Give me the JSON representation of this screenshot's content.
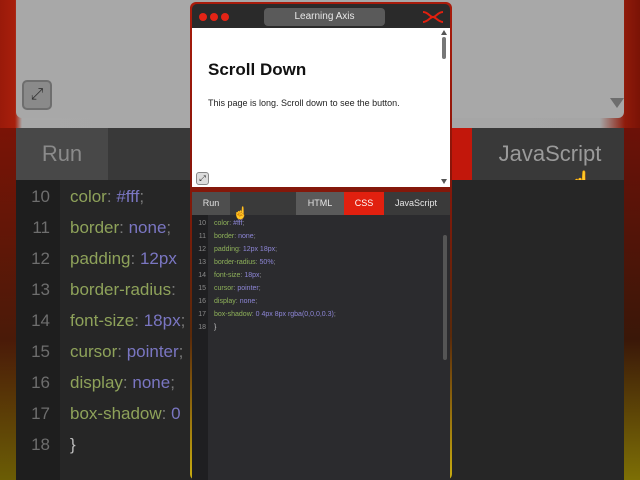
{
  "app": {
    "title": "Learning Axis",
    "brand_color": "#e1200f"
  },
  "preview": {
    "heading": "Scroll Down",
    "body": "This page is long. Scroll down to see the button."
  },
  "tabs": {
    "run": "Run",
    "html": "HTML",
    "css": "CSS",
    "javascript": "JavaScript",
    "active": "CSS"
  },
  "code": {
    "lines": [
      {
        "n": "10",
        "prop": "color",
        "val": "#fff"
      },
      {
        "n": "11",
        "prop": "border",
        "val": "none"
      },
      {
        "n": "12",
        "prop": "padding",
        "val": "12px 18px"
      },
      {
        "n": "13",
        "prop": "border-radius",
        "val": "50%"
      },
      {
        "n": "14",
        "prop": "font-size",
        "val": "18px"
      },
      {
        "n": "15",
        "prop": "cursor",
        "val": "pointer"
      },
      {
        "n": "16",
        "prop": "display",
        "val": "none"
      },
      {
        "n": "17",
        "prop": "box-shadow",
        "val": "0 4px 8px rgba(0,0,0,0.3)"
      },
      {
        "n": "18",
        "prop": "}",
        "val": ""
      }
    ]
  },
  "background": {
    "run": "Run",
    "javascript": "JavaScript",
    "lines": [
      {
        "n": "10",
        "prop": "color",
        "val": "#fff"
      },
      {
        "n": "11",
        "prop": "border",
        "val": "none"
      },
      {
        "n": "12",
        "prop": "padding",
        "val": "12px"
      },
      {
        "n": "13",
        "prop": "border-radius",
        "val": ""
      },
      {
        "n": "14",
        "prop": "font-size",
        "val": "18px"
      },
      {
        "n": "15",
        "prop": "cursor",
        "val": "pointer"
      },
      {
        "n": "16",
        "prop": "display",
        "val": "none"
      },
      {
        "n": "17",
        "prop": "box-shadow",
        "val": "0"
      },
      {
        "n": "18",
        "prop": "}",
        "val": ""
      }
    ]
  }
}
